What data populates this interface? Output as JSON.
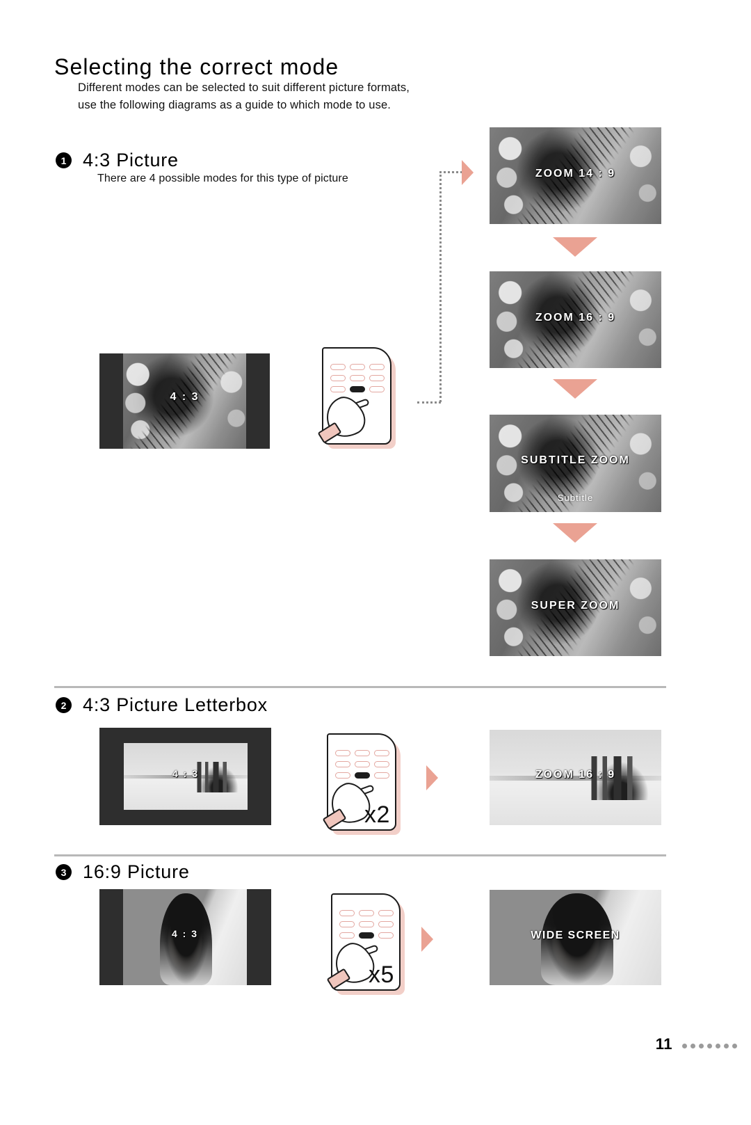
{
  "page": {
    "title": "Selecting the correct mode",
    "intro_line1": "Different modes can be selected to suit different picture formats,",
    "intro_line2": "use the following diagrams as a guide to which mode to use.",
    "page_number": "11",
    "footer_dots": 7,
    "accent_color": "#eaa293",
    "rule_color": "#b8b8b8"
  },
  "sections": [
    {
      "number": "1",
      "title": "4:3 Picture",
      "subtitle": "There are 4 possible modes for this type of picture",
      "source_label": "4 : 3",
      "remote_multiplier": "",
      "results": [
        {
          "label": "ZOOM 14 : 9",
          "sublabel": ""
        },
        {
          "label": "ZOOM 16 : 9",
          "sublabel": ""
        },
        {
          "label": "SUBTITLE ZOOM",
          "sublabel": "Subtitle"
        },
        {
          "label": "SUPER ZOOM",
          "sublabel": ""
        }
      ]
    },
    {
      "number": "2",
      "title": "4:3 Picture Letterbox",
      "subtitle": "",
      "source_label": "4 : 3",
      "remote_multiplier": "x2",
      "results": [
        {
          "label": "ZOOM 16 : 9",
          "sublabel": ""
        }
      ]
    },
    {
      "number": "3",
      "title": "16:9 Picture",
      "subtitle": "",
      "source_label": "4 : 3",
      "remote_multiplier": "x5",
      "results": [
        {
          "label": "WIDE SCREEN",
          "sublabel": ""
        }
      ]
    }
  ]
}
